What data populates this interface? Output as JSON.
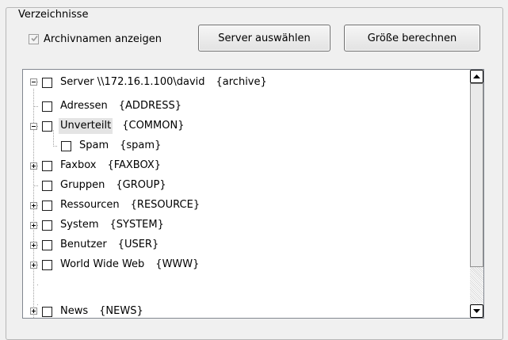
{
  "group": {
    "title": "Verzeichnisse"
  },
  "archiv_checkbox": {
    "label": "Archivnamen anzeigen",
    "checked": true
  },
  "buttons": {
    "server": "Server auswählen",
    "groesse": "Größe berechnen"
  },
  "tree": {
    "root": {
      "label": "Server \\\\172.16.1.100\\david",
      "code": "{archive}",
      "checked": false,
      "expanded": true
    },
    "items": [
      {
        "label": "Adressen",
        "code": "{ADDRESS}",
        "checked": false,
        "expander": "none"
      },
      {
        "label": "Unverteilt",
        "code": "{COMMON}",
        "checked": false,
        "expander": "expanded",
        "selected": true
      },
      {
        "label": "Spam",
        "code": "{spam}",
        "checked": false,
        "expander": "none"
      },
      {
        "label": "Faxbox",
        "code": "{FAXBOX}",
        "checked": false,
        "expander": "collapsed"
      },
      {
        "label": "Gruppen",
        "code": "{GROUP}",
        "checked": false,
        "expander": "none"
      },
      {
        "label": "Ressourcen",
        "code": "{RESOURCE}",
        "checked": false,
        "expander": "collapsed"
      },
      {
        "label": "System",
        "code": "{SYSTEM}",
        "checked": false,
        "expander": "collapsed"
      },
      {
        "label": "Benutzer",
        "code": "{USER}",
        "checked": false,
        "expander": "collapsed"
      },
      {
        "label": "World Wide Web",
        "code": "{WWW}",
        "checked": false,
        "expander": "collapsed"
      },
      {
        "label": "News",
        "code": "{NEWS}",
        "checked": false,
        "expander": "collapsed"
      }
    ]
  },
  "scrollbar": {
    "position": 0
  },
  "icons": {
    "up": "scroll-up-arrow-icon",
    "down": "scroll-down-arrow-icon",
    "check": "checkmark-icon"
  }
}
